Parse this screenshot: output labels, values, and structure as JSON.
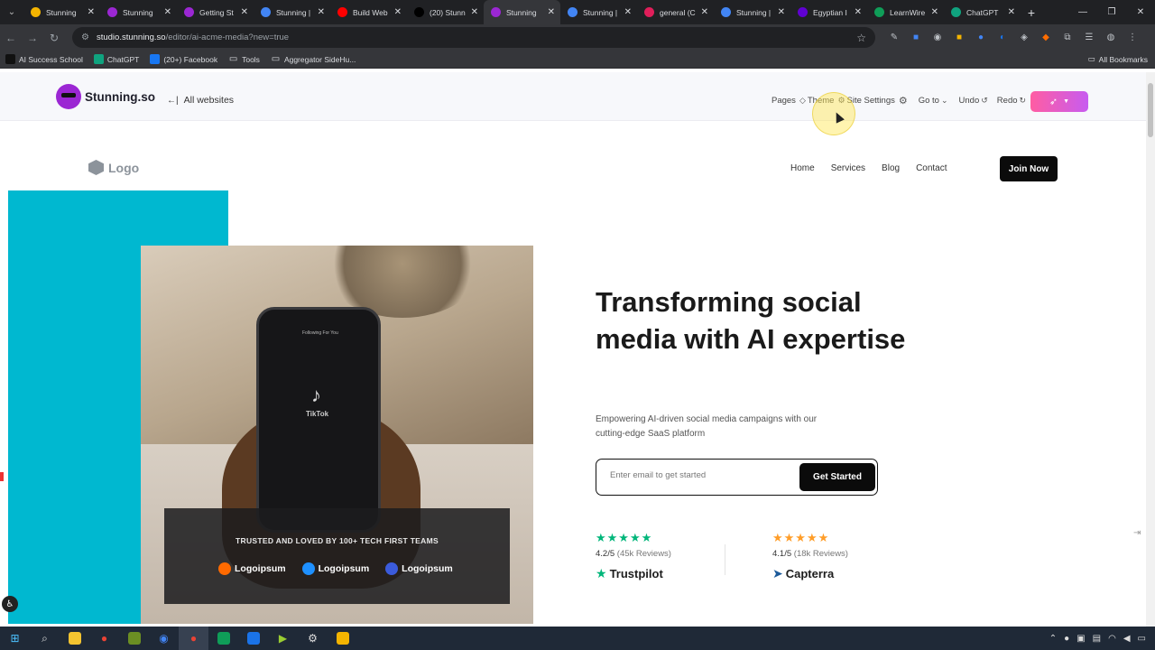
{
  "browser": {
    "tabs": [
      {
        "label": "Stunning",
        "color": "#f4b400"
      },
      {
        "label": "Stunning",
        "color": "#9b27d3"
      },
      {
        "label": "Getting St",
        "color": "#9b27d3"
      },
      {
        "label": "Stunning |",
        "color": "#4285f4"
      },
      {
        "label": "Build Web",
        "color": "#ff0000"
      },
      {
        "label": "(20) Stunn",
        "color": "#000000"
      },
      {
        "label": "Stunning",
        "color": "#9b27d3",
        "active": true
      },
      {
        "label": "Stunning |",
        "color": "#4285f4"
      },
      {
        "label": "general (C",
        "color": "#e01e5a"
      },
      {
        "label": "Stunning |",
        "color": "#4285f4"
      },
      {
        "label": "Egyptian I",
        "color": "#6001d2"
      },
      {
        "label": "LearnWire",
        "color": "#0f9d58"
      },
      {
        "label": "ChatGPT",
        "color": "#10a37f"
      }
    ],
    "url_host": "studio.stunning.so",
    "url_path": "/editor/ai-acme-media?new=true",
    "bookmarks": [
      {
        "label": "AI Success School",
        "color": "#111111"
      },
      {
        "label": "ChatGPT",
        "color": "#10a37f"
      },
      {
        "label": "(20+) Facebook",
        "color": "#1877f2"
      },
      {
        "label": "Tools",
        "color": "folder"
      },
      {
        "label": "Aggregator SideHu...",
        "color": "folder"
      }
    ],
    "all_bookmarks": "All Bookmarks"
  },
  "editor": {
    "brand": "Stunning.so",
    "all_websites": "All websites",
    "menu": {
      "pages": "Pages",
      "theme": "Theme",
      "site_settings": "Site Settings",
      "go_to": "Go to",
      "undo": "Undo",
      "redo": "Redo"
    },
    "publish_icon": "rocket-icon"
  },
  "site": {
    "logo_text": "Logo",
    "nav": [
      "Home",
      "Services",
      "Blog",
      "Contact"
    ],
    "join_label": "Join Now",
    "headline": "Transforming social media with AI expertise",
    "subtext": "Empowering AI-driven social media campaigns with our cutting-edge SaaS platform",
    "email_placeholder": "Enter email to get started",
    "cta_label": "Get Started",
    "trusted_title": "TRUSTED AND LOVED BY 100+ TECH FIRST TEAMS",
    "partner_logos": [
      "Logoipsum",
      "Logoipsum",
      "Logoipsum"
    ],
    "phone_header": "Following   For You",
    "phone_app": "TikTok",
    "reviews": [
      {
        "stars": "★★★★★",
        "score": "4.2/5",
        "count": "(45k Reviews)",
        "brand": "Trustpilot",
        "color": "#00b67a"
      },
      {
        "stars": "★★★★★",
        "score": "4.1/5",
        "count": "(18k Reviews)",
        "brand": "Capterra",
        "color": "#ff9d28"
      }
    ]
  }
}
